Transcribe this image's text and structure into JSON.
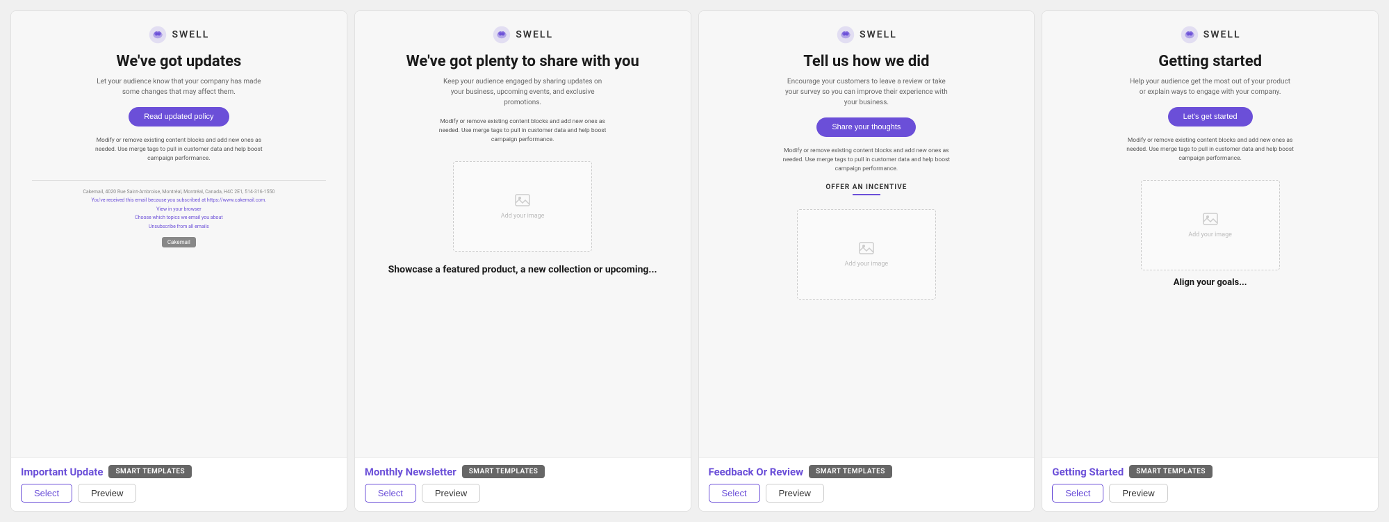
{
  "cards": [
    {
      "id": "important-update",
      "name": "Important Update",
      "badge": "SMART TEMPLATES",
      "email": {
        "logo_text": "SWELL",
        "title": "We've got updates",
        "subtitle": "Let your audience know that your company has made some changes that may affect them.",
        "body_text": "Modify or remove existing content blocks and add new ones as needed. Use merge tags to pull in customer data and help boost campaign performance.",
        "cta_label": "Read updated policy",
        "show_divider": true,
        "footer_lines": [
          "Cakemail, 4020 Rue Saint-Ambroise, Montréal, Montréal, Canada, H4C 2E1, 514-316-1550",
          "You've received this email because you subscribed at https://www.cakemail.com.",
          "View in your browser",
          "Choose which topics we email you about",
          "Unsubscribe from all emails"
        ],
        "show_cakemail_badge": true,
        "cakemail_badge_text": "Cakemail",
        "show_image": false,
        "show_offer": false,
        "show_align_goals": false
      },
      "select_label": "Select",
      "preview_label": "Preview"
    },
    {
      "id": "monthly-newsletter",
      "name": "Monthly Newsletter",
      "badge": "SMART TEMPLATES",
      "email": {
        "logo_text": "SWELL",
        "title": "We've got plenty to share with you",
        "subtitle": "Keep your audience engaged by sharing updates on your business, upcoming events, and exclusive promotions.",
        "body_text": "Modify or remove existing content blocks and add new ones as needed. Use merge tags to pull in customer data and help boost campaign performance.",
        "cta_label": "",
        "show_divider": false,
        "footer_lines": [],
        "show_cakemail_badge": false,
        "cakemail_badge_text": "",
        "show_image": true,
        "image_alt": "Add your image",
        "show_offer": false,
        "show_align_goals": false,
        "bottom_text": "Showcase a featured product, a new collection or upcoming..."
      },
      "select_label": "Select",
      "preview_label": "Preview"
    },
    {
      "id": "feedback-or-review",
      "name": "Feedback Or Review",
      "badge": "SMART TEMPLATES",
      "email": {
        "logo_text": "SWELL",
        "title": "Tell us how we did",
        "subtitle": "Encourage your customers to leave a review or take your survey so you can improve their experience with your business.",
        "body_text": "Modify or remove existing content blocks and add new ones as needed. Use merge tags to pull in customer data and help boost campaign performance.",
        "cta_label": "Share your thoughts",
        "show_divider": false,
        "footer_lines": [],
        "show_cakemail_badge": false,
        "cakemail_badge_text": "",
        "show_image": true,
        "image_alt": "Add your image",
        "show_offer": true,
        "offer_label": "OFFER AN INCENTIVE",
        "show_align_goals": false
      },
      "select_label": "Select",
      "preview_label": "Preview"
    },
    {
      "id": "getting-started",
      "name": "Getting Started",
      "badge": "SMART TEMPLATES",
      "email": {
        "logo_text": "SWELL",
        "title": "Getting started",
        "subtitle": "Help your audience get the most out of your product or explain ways to engage with your company.",
        "body_text": "Modify or remove existing content blocks and add new ones as needed. Use merge tags to pull in customer data and help boost campaign performance.",
        "cta_label": "Let's get started",
        "show_divider": false,
        "footer_lines": [],
        "show_cakemail_badge": false,
        "cakemail_badge_text": "",
        "show_image": true,
        "image_alt": "Add your image",
        "show_offer": false,
        "show_align_goals": true,
        "align_goals_text": "Align your goals..."
      },
      "select_label": "Select",
      "preview_label": "Preview"
    }
  ]
}
